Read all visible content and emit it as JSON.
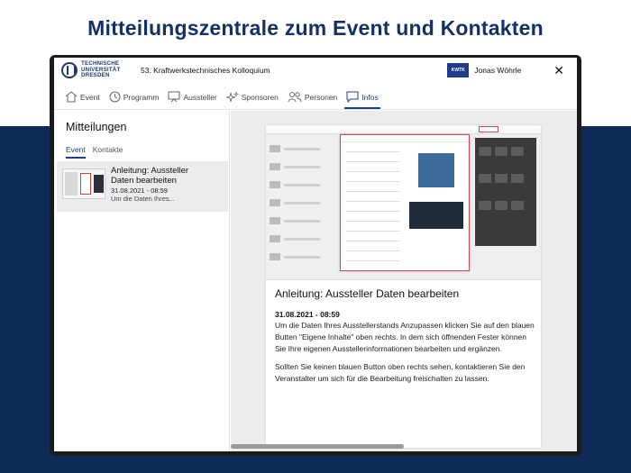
{
  "headline": "Mitteilungszentrale zum Event und Kontakten",
  "app": {
    "logo_lines": [
      "TECHNISCHE",
      "UNIVERSITÄT",
      "DRESDEN"
    ],
    "event_title": "53. Kraftwerkstechnisches Kolloquium",
    "user_badge": "KWTK",
    "user_name": "Jonas Wöhrle",
    "close_symbol": "✕"
  },
  "nav": {
    "items": [
      {
        "label": "Event",
        "icon": "home-icon"
      },
      {
        "label": "Programm",
        "icon": "clock-icon"
      },
      {
        "label": "Aussteller",
        "icon": "easel-icon"
      },
      {
        "label": "Sponsoren",
        "icon": "sparkle-icon"
      },
      {
        "label": "Personen",
        "icon": "people-icon"
      },
      {
        "label": "Infos",
        "icon": "chat-icon"
      }
    ],
    "active": "Infos"
  },
  "sidebar": {
    "title": "Mitteilungen",
    "tabs": [
      "Event",
      "Kontakte"
    ],
    "active_tab": "Event",
    "messages": [
      {
        "title": "Anleitung: Aussteller Daten bearbeiten",
        "date": "31.08.2021 - 08:59",
        "snippet": "Um die Daten Ihres..."
      }
    ]
  },
  "detail": {
    "title": "Anleitung: Aussteller Daten bearbeiten",
    "date": "31.08.2021 - 08:59",
    "paragraph1": "Um die Daten Ihres Ausstellerstands Anzupassen klicken Sie auf den blauen Butten \"Eigene Inhalte\" oben rechts. In dem sich öffnenden Fester können Sie Ihre eigenen Ausstellerinformationen bearbeiten und ergänzen.",
    "paragraph2": "Sollten Sie keinen blauen Button oben rechts sehen, kontaktieren Sie den Veranstalter um sich für die Bearbeitung freischalten zu lassen."
  },
  "colors": {
    "navy": "#0f2a57",
    "headline": "#123266",
    "accent": "#1a3f8a",
    "highlight_red": "#d34a4a"
  }
}
